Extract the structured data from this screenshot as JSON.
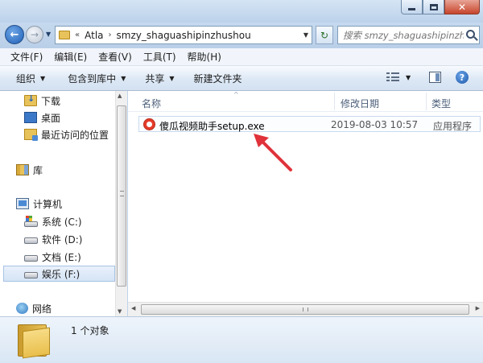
{
  "window": {
    "minimize_glyph": "—",
    "close_glyph": "✕"
  },
  "address": {
    "breadcrumbs": [
      "«",
      "Atla",
      "›",
      "smzy_shaguashipinzhushou"
    ],
    "search_placeholder": "搜索 smzy_shaguashipinzhushou"
  },
  "menu": {
    "items": [
      "文件(F)",
      "编辑(E)",
      "查看(V)",
      "工具(T)",
      "帮助(H)"
    ]
  },
  "toolbar": {
    "organize": "组织",
    "include_library": "包含到库中",
    "share": "共享",
    "new_folder": "新建文件夹"
  },
  "nav": {
    "favorites": [
      "下载",
      "桌面",
      "最近访问的位置"
    ],
    "library": "库",
    "computer": "计算机",
    "drives": [
      "系统 (C:)",
      "软件 (D:)",
      "文档 (E:)",
      "娱乐 (F:)"
    ],
    "network": "网络"
  },
  "columns": {
    "name": "名称",
    "date": "修改日期",
    "type": "类型"
  },
  "files": [
    {
      "name": "傻瓜视频助手setup.exe",
      "date": "2019-08-03 10:57",
      "type": "应用程序"
    }
  ],
  "details": {
    "count": "1 个对象"
  },
  "colors": {
    "annotation_arrow": "#e0323a",
    "selection_border": "#a7c3e5"
  }
}
